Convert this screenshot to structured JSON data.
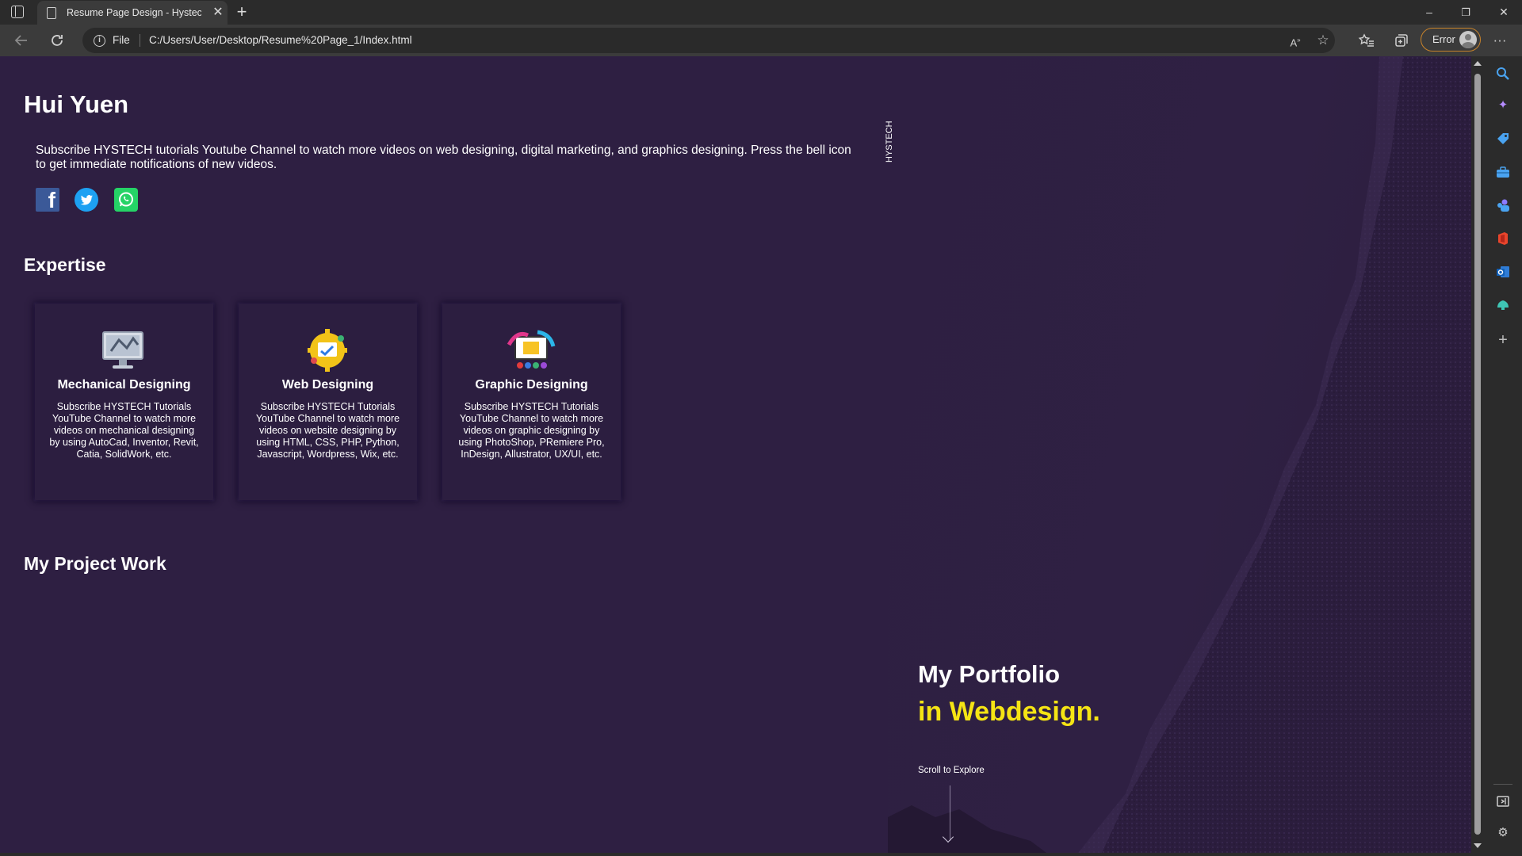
{
  "browser": {
    "tab_title": "Resume Page Design - Hystech T",
    "tab_close": "✕",
    "new_tab": "+",
    "omnibox_scheme": "File",
    "url": "C:/Users/User/Desktop/Resume%20Page_1/Index.html",
    "profile_status": "Error",
    "window_controls": {
      "minimize": "–",
      "restore": "❐",
      "close": "✕"
    },
    "toolbar_icons": [
      "back-icon",
      "refresh-icon",
      "read-aloud-icon",
      "add-favorite-icon",
      "favorites-icon",
      "collections-icon",
      "more-icon"
    ],
    "sidebar_icons": [
      "search-icon",
      "copilot-icon",
      "shopping-icon",
      "tools-icon",
      "games-icon",
      "office-icon",
      "outlook-icon",
      "drop-icon",
      "add-icon",
      "screen-icon",
      "settings-icon"
    ]
  },
  "page": {
    "name": "Hui Yuen",
    "intro": "Subscribe HYSTECH tutorials Youtube Channel to watch more videos on web designing, digital marketing, and graphics designing. Press the bell icon to get immediate notifications of new videos.",
    "social": [
      "facebook-icon",
      "twitter-icon",
      "whatsapp-icon"
    ],
    "vertical_label": "HYSTECH",
    "expertise_title": "Expertise",
    "cards": [
      {
        "title": "Mechanical Designing",
        "text": "Subscribe HYSTECH Tutorials YouTube Channel to watch more videos on mechanical designing by using AutoCad, Inventor, Revit, Catia, SolidWork, etc.",
        "icon": "monitor-3d-icon"
      },
      {
        "title": "Web Designing",
        "text": "Subscribe HYSTECH Tutorials YouTube Channel to watch more videos on website designing by using HTML, CSS, PHP, Python, Javascript, Wordpress, Wix, etc.",
        "icon": "web-gear-icon"
      },
      {
        "title": "Graphic Designing",
        "text": "Subscribe HYSTECH Tutorials YouTube Channel to watch more videos on graphic designing by using PhotoShop, PRemiere Pro, InDesign, Allustrator, UX/UI, etc.",
        "icon": "graphic-palette-icon"
      }
    ],
    "projects_title": "My Project Work",
    "hero_line1": "My Portfolio",
    "hero_line2": "in Webdesign.",
    "scroll_text": "Scroll to Explore"
  },
  "colors": {
    "page_bg": "#2e1f42",
    "accent_yellow": "#f5e414",
    "facebook": "#3b5998",
    "twitter": "#1da1f2",
    "whatsapp": "#25d366"
  }
}
